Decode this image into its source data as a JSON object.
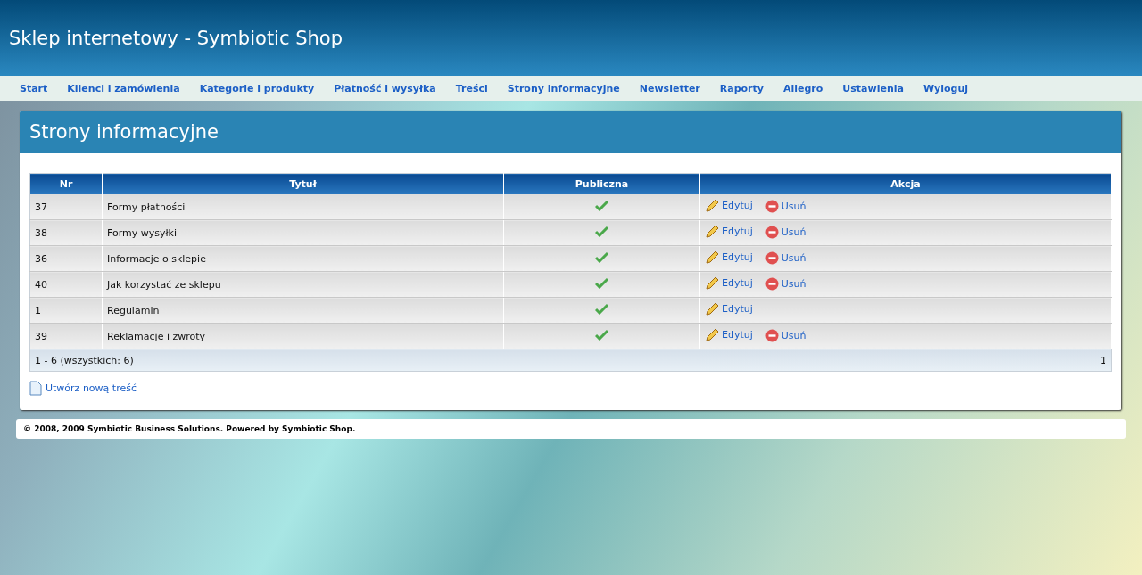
{
  "header": {
    "title": "Sklep internetowy - Symbiotic Shop"
  },
  "nav": [
    "Start",
    "Klienci i zamówienia",
    "Kategorie i produkty",
    "Płatność i wysyłka",
    "Treści",
    "Strony informacyjne",
    "Newsletter",
    "Raporty",
    "Allegro",
    "Ustawienia",
    "Wyloguj"
  ],
  "panel": {
    "title": "Strony informacyjne",
    "table": {
      "columns": [
        "Nr",
        "Tytuł",
        "Publiczna",
        "Akcja"
      ],
      "rows": [
        {
          "nr": "37",
          "title": "Formy płatności",
          "public": true,
          "actions": [
            {
              "kind": "edit",
              "label": "Edytuj"
            },
            {
              "kind": "delete",
              "label": "Usuń"
            }
          ]
        },
        {
          "nr": "38",
          "title": "Formy wysyłki",
          "public": true,
          "actions": [
            {
              "kind": "edit",
              "label": "Edytuj"
            },
            {
              "kind": "delete",
              "label": "Usuń"
            }
          ]
        },
        {
          "nr": "36",
          "title": "Informacje o sklepie",
          "public": true,
          "actions": [
            {
              "kind": "edit",
              "label": "Edytuj"
            },
            {
              "kind": "delete",
              "label": "Usuń"
            }
          ]
        },
        {
          "nr": "40",
          "title": "Jak korzystać ze sklepu",
          "public": true,
          "actions": [
            {
              "kind": "edit",
              "label": "Edytuj"
            },
            {
              "kind": "delete",
              "label": "Usuń"
            }
          ]
        },
        {
          "nr": "1",
          "title": "Regulamin",
          "public": true,
          "actions": [
            {
              "kind": "edit",
              "label": "Edytuj"
            }
          ]
        },
        {
          "nr": "39",
          "title": "Reklamacje i zwroty",
          "public": true,
          "actions": [
            {
              "kind": "edit",
              "label": "Edytuj"
            },
            {
              "kind": "delete",
              "label": "Usuń"
            }
          ]
        }
      ],
      "summary": "1 - 6 (wszystkich: 6)",
      "page": "1"
    },
    "create_link": "Utwórz nową treść"
  },
  "footer": "© 2008, 2009 Symbiotic Business Solutions. Powered by Symbiotic Shop."
}
